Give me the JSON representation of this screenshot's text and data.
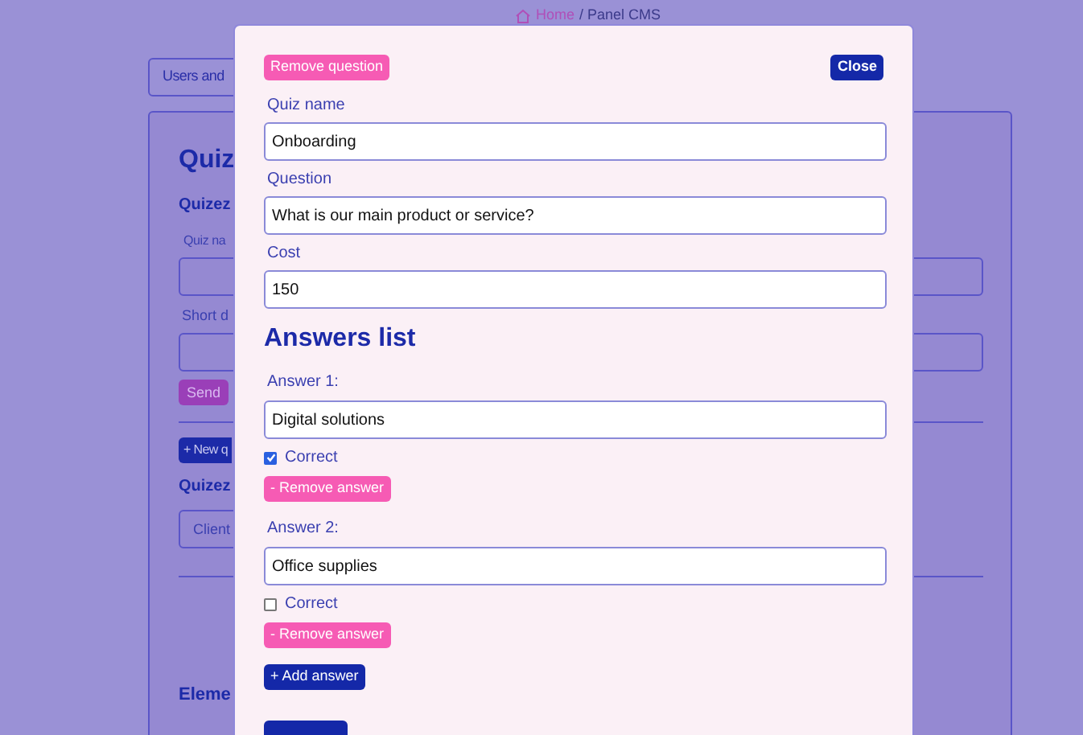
{
  "breadcrumb": {
    "home": "Home",
    "current": "/ Panel CMS"
  },
  "background": {
    "tab_button": "Users and",
    "heading": "Quiz",
    "subheading": "Quizez",
    "field_1_label": "Quiz na",
    "field_2_label": "Short d",
    "send_button": "Send",
    "new_button": "+ New q",
    "list_heading": "Quizez",
    "list_item": "Client",
    "elements_heading": "Eleme"
  },
  "modal": {
    "remove_question": "Remove question",
    "close": "Close",
    "fields": [
      {
        "label": "Quiz name",
        "value": "Onboarding"
      },
      {
        "label": "Question",
        "value": "What is our main product or service?"
      },
      {
        "label": "Cost",
        "value": "150"
      }
    ],
    "answers_heading": "Answers list",
    "answers": [
      {
        "label": "Answer 1:",
        "value": "Digital solutions",
        "correct_label": "Correct",
        "checked": true,
        "remove": "- Remove answer"
      },
      {
        "label": "Answer 2:",
        "value": "Office supplies",
        "correct_label": "Correct",
        "checked": false,
        "remove": "- Remove answer"
      }
    ],
    "add_answer": "+ Add answer"
  }
}
